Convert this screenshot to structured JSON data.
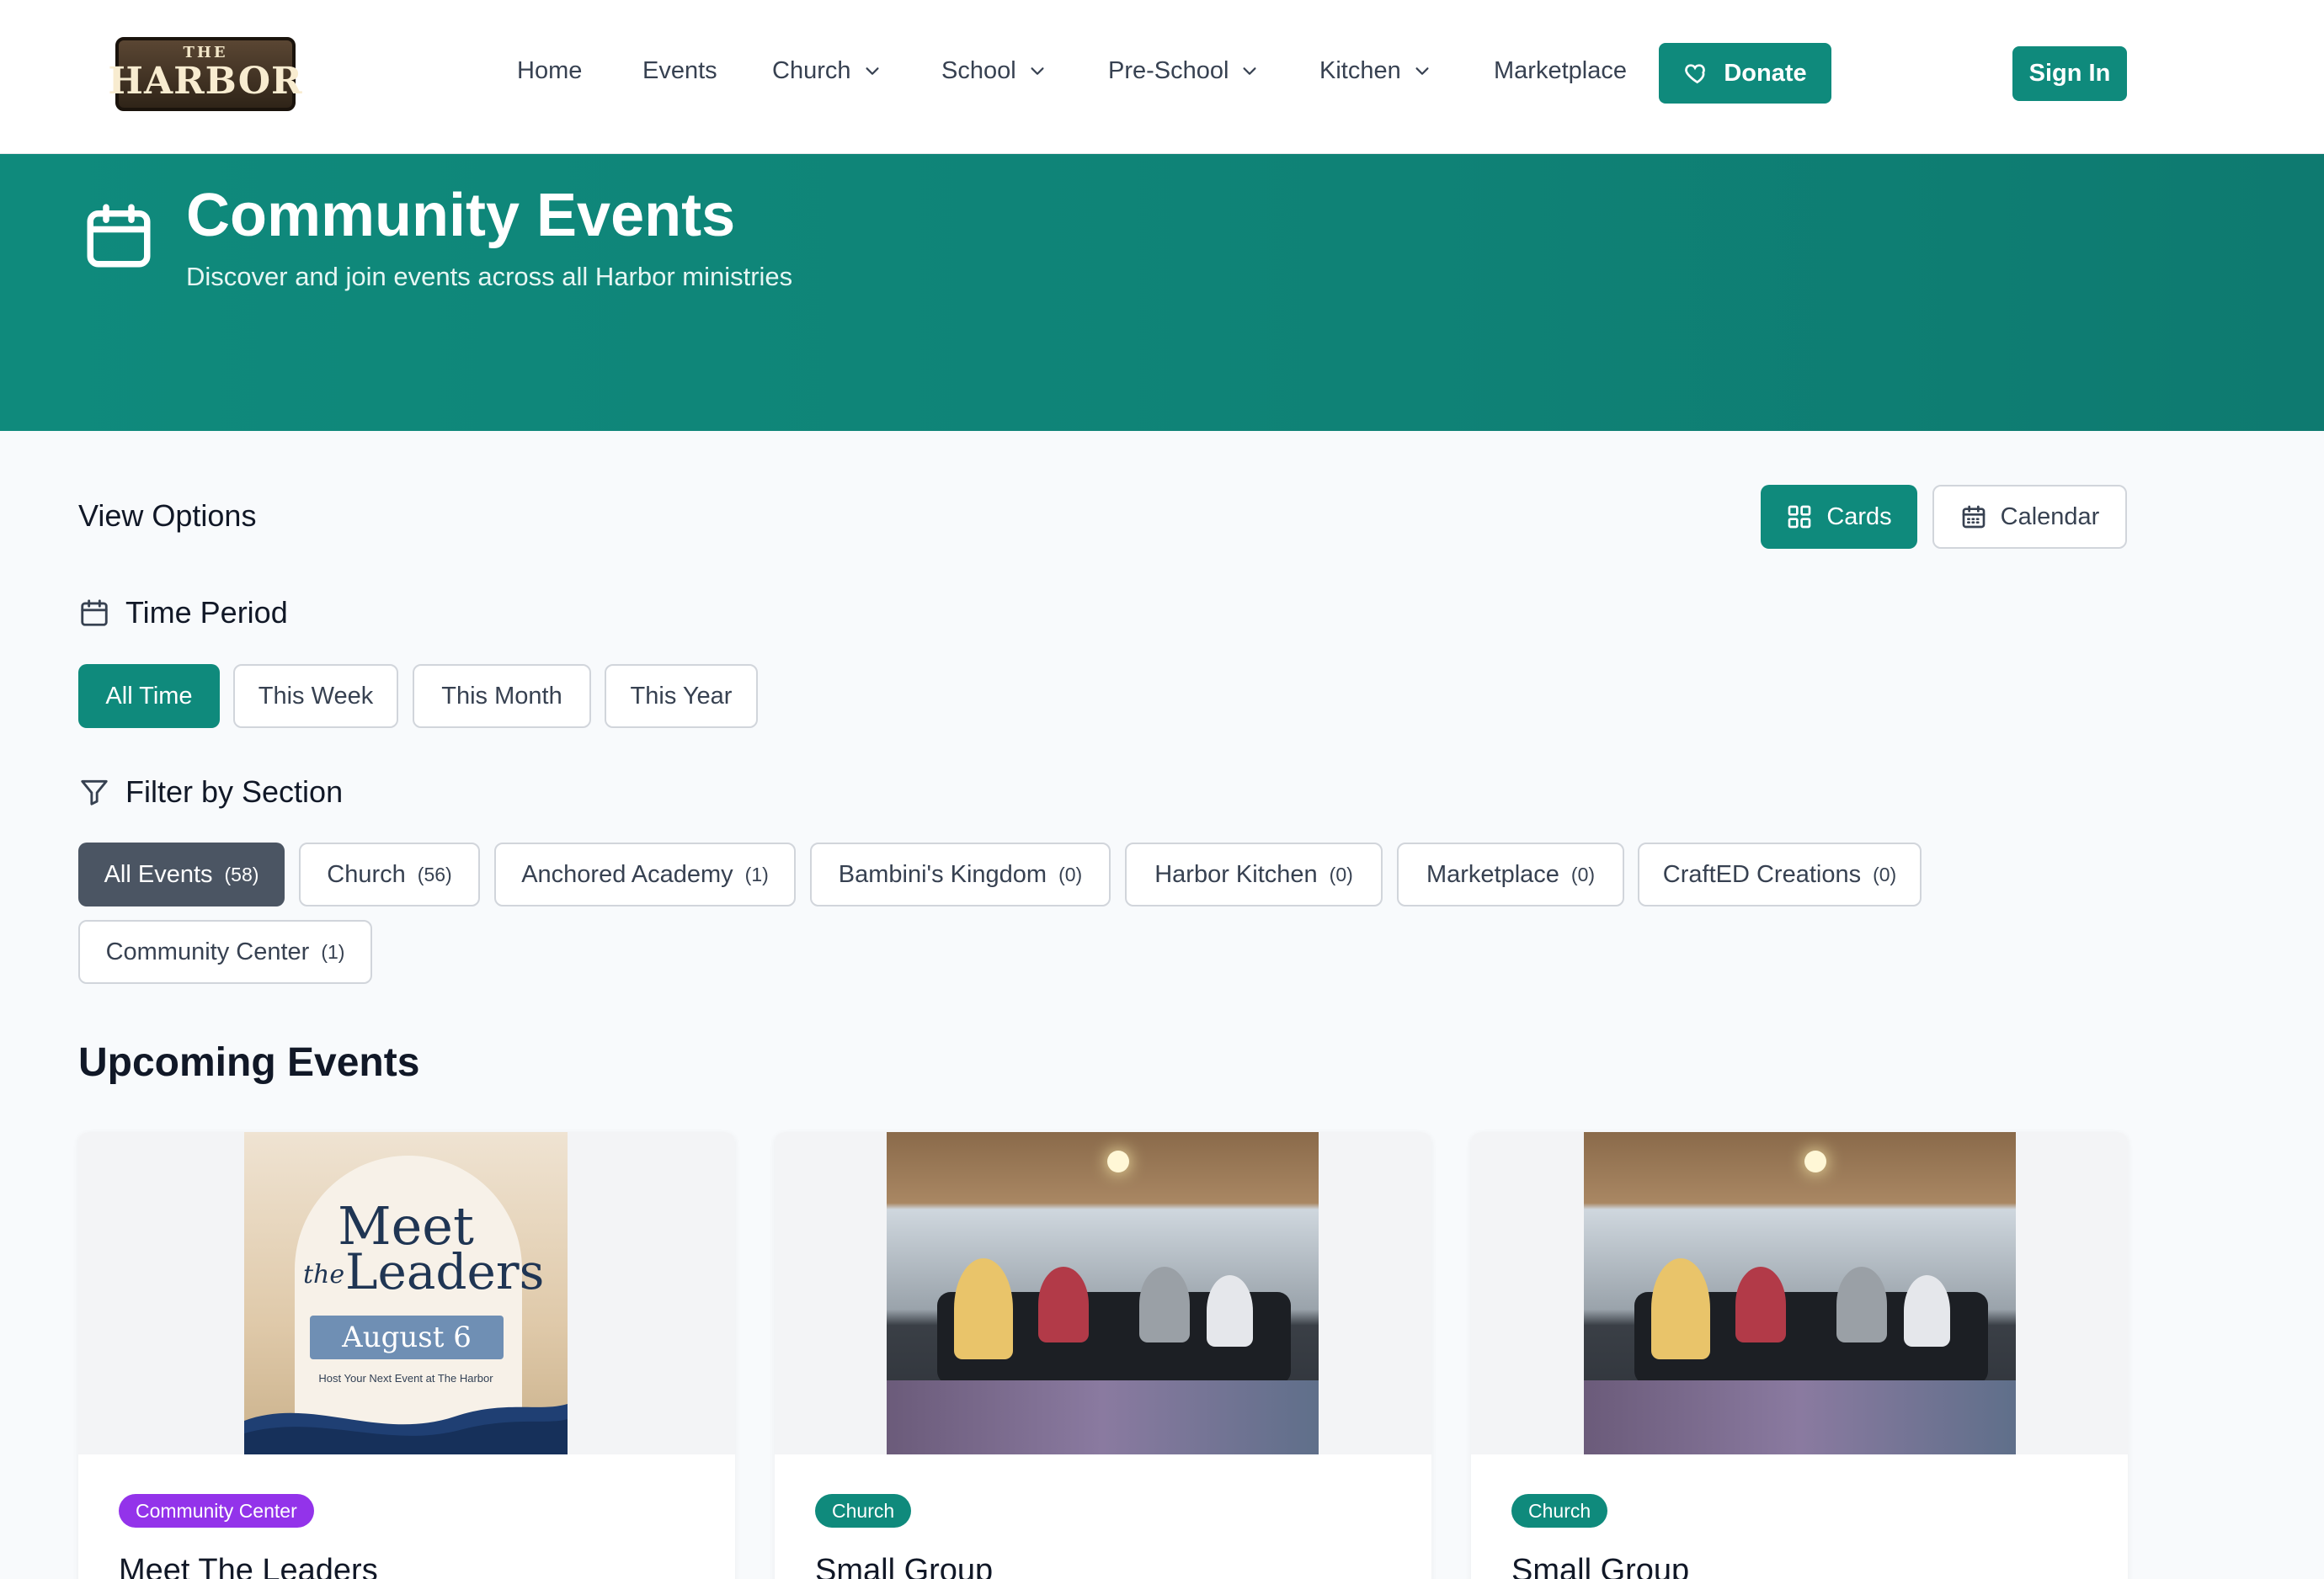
{
  "header": {
    "logo_small": "THE",
    "logo_main": "HARBOR",
    "nav": [
      {
        "label": "Home",
        "dropdown": false
      },
      {
        "label": "Events",
        "dropdown": false
      },
      {
        "label": "Church",
        "dropdown": true
      },
      {
        "label": "School",
        "dropdown": true
      },
      {
        "label": "Pre-School",
        "dropdown": true
      },
      {
        "label": "Kitchen",
        "dropdown": true
      },
      {
        "label": "Marketplace",
        "dropdown": false
      }
    ],
    "donate_label": "Donate",
    "signin_label": "Sign In"
  },
  "hero": {
    "title": "Community Events",
    "subtitle": "Discover and join events across all Harbor ministries"
  },
  "view_options": {
    "title": "View Options",
    "cards_label": "Cards",
    "calendar_label": "Calendar",
    "active": "Cards"
  },
  "time_period": {
    "title": "Time Period",
    "options": [
      "All Time",
      "This Week",
      "This Month",
      "This Year"
    ],
    "active": "All Time"
  },
  "filter": {
    "title": "Filter by Section",
    "options": [
      {
        "label": "All Events",
        "count": "(58)"
      },
      {
        "label": "Church",
        "count": "(56)"
      },
      {
        "label": "Anchored Academy",
        "count": "(1)"
      },
      {
        "label": "Bambini's Kingdom",
        "count": "(0)"
      },
      {
        "label": "Harbor Kitchen",
        "count": "(0)"
      },
      {
        "label": "Marketplace",
        "count": "(0)"
      },
      {
        "label": "CraftED Creations",
        "count": "(0)"
      },
      {
        "label": "Community Center",
        "count": "(1)"
      }
    ],
    "active": "All Events"
  },
  "upcoming": {
    "title": "Upcoming Events",
    "cards": [
      {
        "badge": "Community Center",
        "badge_color": "#9333ea",
        "title": "Meet The Leaders",
        "poster": {
          "line1": "Meet",
          "line2a": "the",
          "line2b": "Leaders",
          "date": "August 6",
          "tagline": "Host Your Next Event at The Harbor"
        }
      },
      {
        "badge": "Church",
        "badge_color": "#0f8a7c",
        "title": "Small Group"
      },
      {
        "badge": "Church",
        "badge_color": "#0f8a7c",
        "title": "Small Group"
      }
    ]
  },
  "colors": {
    "primary": "#0f8a7c",
    "dark_pill": "#4b5563",
    "purple_badge": "#9333ea"
  }
}
